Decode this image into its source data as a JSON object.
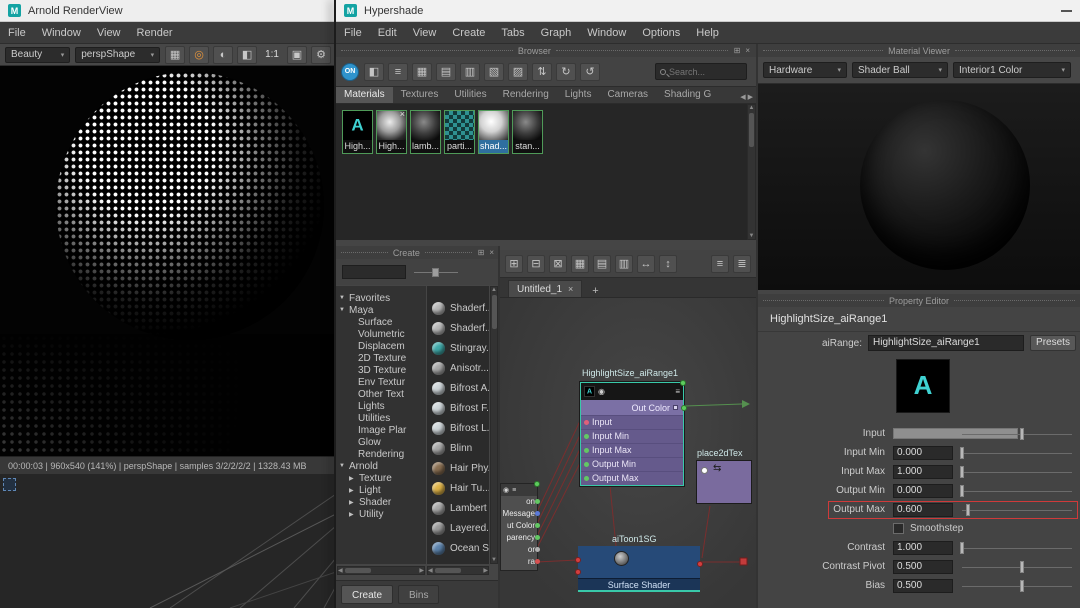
{
  "rv": {
    "title": "Arnold RenderView",
    "menu": [
      "File",
      "Window",
      "View",
      "Render"
    ],
    "aov": "Beauty",
    "camera": "perspShape",
    "zoom": "1:1",
    "icons_a": [
      {
        "name": "aov-grid-icon",
        "glyph": "▦",
        "color": "#c8c8c8"
      },
      {
        "name": "render-region-icon",
        "glyph": "◎",
        "color": "#e8953a"
      },
      {
        "name": "hdr-display-icon",
        "glyph": "◐",
        "color": "#c8c8c8"
      },
      {
        "name": "ab-compare-icon",
        "glyph": "◧",
        "color": "#c8c8c8"
      }
    ],
    "icons_b": [
      {
        "name": "snapshot-icon",
        "glyph": "▣",
        "color": "#c8c8c8"
      },
      {
        "name": "display-settings-gear-icon",
        "glyph": "⚙",
        "color": "#c8c8c8"
      }
    ],
    "status": "00:00:03 | 960x540 (141%) | perspShape | samples 3/2/2/2/2 | 1328.43 MB"
  },
  "hs": {
    "title": "Hypershade",
    "menu": [
      "File",
      "Edit",
      "View",
      "Create",
      "Tabs",
      "Graph",
      "Window",
      "Options",
      "Help"
    ],
    "panel_icons": [
      {
        "name": "float-panel-icon",
        "glyph": "⊞"
      },
      {
        "name": "close-panel-icon",
        "glyph": "×"
      }
    ],
    "browser": {
      "header": "Browser",
      "on_label": "ON",
      "toolbar_icons": [
        {
          "name": "palette-display-icon",
          "glyph": "◧"
        },
        {
          "name": "list-view-icon",
          "glyph": "≡"
        },
        {
          "name": "swatch-small-icon",
          "glyph": "▦"
        },
        {
          "name": "swatch-medium-icon",
          "glyph": "▤"
        },
        {
          "name": "swatch-large-icon",
          "glyph": "▥"
        },
        {
          "name": "swatch-xlarge-icon",
          "glyph": "▧"
        },
        {
          "name": "swatch-grid-icon",
          "glyph": "▨"
        },
        {
          "name": "sort-icon",
          "glyph": "⇅"
        },
        {
          "name": "refresh-swatch-icon",
          "glyph": "↻"
        },
        {
          "name": "refresh-all-icon",
          "glyph": "↺"
        }
      ],
      "search_placeholder": "Search...",
      "tabs": [
        {
          "label": "Materials",
          "cls": "active"
        },
        {
          "label": "Textures",
          "cls": ""
        },
        {
          "label": "Utilities",
          "cls": ""
        },
        {
          "label": "Rendering",
          "cls": ""
        },
        {
          "label": "Lights",
          "cls": ""
        },
        {
          "label": "Cameras",
          "cls": ""
        },
        {
          "label": "Shading G",
          "cls": ""
        }
      ],
      "swatches": [
        {
          "label": "High...",
          "cls": "sw-arnold",
          "lcls": ""
        },
        {
          "label": "High...",
          "cls": "sw-ball-gray badge-x",
          "lcls": ""
        },
        {
          "label": "lamb...",
          "cls": "sw-ball-dark",
          "lcls": ""
        },
        {
          "label": "parti...",
          "cls": "sw-checker",
          "lcls": ""
        },
        {
          "label": "shad...",
          "cls": "sw-ball-light",
          "lcls": "sel"
        },
        {
          "label": "stan...",
          "cls": "sw-ball-dark",
          "lcls": ""
        }
      ]
    },
    "create": {
      "header": "Create",
      "tree": [
        {
          "label": "Favorites",
          "arrow": "▼",
          "pad": "3px"
        },
        {
          "label": "Maya",
          "arrow": "▼",
          "pad": "3px"
        },
        {
          "label": "Surface",
          "arrow": "",
          "pad": "22px"
        },
        {
          "label": "Volumetric",
          "arrow": "",
          "pad": "22px"
        },
        {
          "label": "Displacem",
          "arrow": "",
          "pad": "22px"
        },
        {
          "label": "2D Texture",
          "arrow": "",
          "pad": "22px"
        },
        {
          "label": "3D Texture",
          "arrow": "",
          "pad": "22px"
        },
        {
          "label": "Env Textur",
          "arrow": "",
          "pad": "22px"
        },
        {
          "label": "Other Text",
          "arrow": "",
          "pad": "22px"
        },
        {
          "label": "Lights",
          "arrow": "",
          "pad": "22px"
        },
        {
          "label": "Utilities",
          "arrow": "",
          "pad": "22px"
        },
        {
          "label": "Image Plar",
          "arrow": "",
          "pad": "22px"
        },
        {
          "label": "Glow",
          "arrow": "",
          "pad": "22px"
        },
        {
          "label": "Rendering",
          "arrow": "",
          "pad": "22px"
        },
        {
          "label": "Arnold",
          "arrow": "▼",
          "pad": "3px"
        },
        {
          "label": "Texture",
          "arrow": "▶",
          "pad": "13px"
        },
        {
          "label": "Light",
          "arrow": "▶",
          "pad": "13px"
        },
        {
          "label": "Shader",
          "arrow": "▶",
          "pad": "13px"
        },
        {
          "label": "Utility",
          "arrow": "▶",
          "pad": "13px"
        }
      ],
      "nodes": [
        {
          "label": "Shaderf...",
          "color": "#b8b8b8"
        },
        {
          "label": "Shaderf...",
          "color": "#b8b8b8"
        },
        {
          "label": "Stingray...",
          "color": "#3fa9a9"
        },
        {
          "label": "Anisotr...",
          "color": "#a8a8a8"
        },
        {
          "label": "Bifrost A...",
          "color": "#cfd6da"
        },
        {
          "label": "Bifrost F...",
          "color": "#cfd6da"
        },
        {
          "label": "Bifrost L...",
          "color": "#cfd6da"
        },
        {
          "label": "Blinn",
          "color": "#a8a8a8"
        },
        {
          "label": "Hair Phy...",
          "color": "#8a6f52"
        },
        {
          "label": "Hair Tu...",
          "color": "#dfb347"
        },
        {
          "label": "Lambert",
          "color": "#a8a8a8"
        },
        {
          "label": "Layered...",
          "color": "#9a9a9a"
        },
        {
          "label": "Ocean S...",
          "color": "#5d84ad"
        }
      ],
      "tabs": [
        {
          "label": "Create",
          "cls": "active"
        },
        {
          "label": "Bins",
          "cls": ""
        }
      ]
    },
    "editor": {
      "toolbar_icons": [
        {
          "name": "input-connections-icon",
          "glyph": "⊞"
        },
        {
          "name": "io-connections-icon",
          "glyph": "⊟"
        },
        {
          "name": "output-connections-icon",
          "glyph": "⊠"
        },
        {
          "name": "layout-grid-icon",
          "glyph": "▦"
        },
        {
          "name": "align-horizontal-icon",
          "glyph": "▤"
        },
        {
          "name": "align-vertical-icon",
          "glyph": "▥"
        },
        {
          "name": "distribute-icon",
          "glyph": "↔"
        },
        {
          "name": "frame-all-icon",
          "glyph": "↕"
        }
      ],
      "view_icons": [
        {
          "name": "simple-view-icon",
          "glyph": "≡"
        },
        {
          "name": "detailed-view-icon",
          "glyph": "≣"
        }
      ],
      "tab": "Untitled_1",
      "tab_close": "×",
      "tab_add": "+",
      "range": {
        "title": "HighlightSize_aiRange1",
        "out": "Out Color",
        "rows": [
          {
            "label": "Input",
            "dot": "#e0607a"
          },
          {
            "label": "Input Min",
            "dot": "#63c763"
          },
          {
            "label": "Input Max",
            "dot": "#63c763"
          },
          {
            "label": "Output Min",
            "dot": "#63c763"
          },
          {
            "label": "Output Max",
            "dot": "#63c763"
          }
        ]
      },
      "place2d": {
        "title": "place2dTex"
      },
      "sg": {
        "title": "aiToon1SG",
        "footer": "Surface Shader"
      },
      "partial_rows": [
        {
          "label": "on",
          "dot": "#63c763"
        },
        {
          "label": "Message",
          "dot": "#5b79d8"
        },
        {
          "label": "ut Color",
          "dot": "#63c763"
        },
        {
          "label": "parency",
          "dot": "#63c763"
        },
        {
          "label": "or",
          "dot": "#b0b0b0"
        },
        {
          "label": "ra",
          "dot": "#d85050"
        }
      ]
    }
  },
  "mv": {
    "header": "Material Viewer",
    "renderer": "Hardware",
    "geometry": "Shader Ball",
    "environment": "Interior1 Color"
  },
  "pe": {
    "header": "Property Editor",
    "node_name": "HighlightSize_aiRange1",
    "type_label": "aiRange:",
    "type_value": "HighlightSize_aiRange1",
    "presets": "Presets",
    "attributes": [
      {
        "label": "Input",
        "is_bar": true,
        "has_slider": true,
        "handle": "53%"
      },
      {
        "label": "Input Min",
        "value": "0.000",
        "has_value": true,
        "has_slider": true,
        "handle": "0%"
      },
      {
        "label": "Input Max",
        "value": "1.000",
        "has_value": true,
        "has_slider": true,
        "handle": "0%"
      },
      {
        "label": "Output Min",
        "value": "0.000",
        "has_value": true,
        "has_slider": true,
        "handle": "0%"
      },
      {
        "label": "Output Max",
        "value": "0.600",
        "has_value": true,
        "has_slider": true,
        "handle": "5%",
        "highlight": true
      },
      {
        "label_after": "Smoothstep",
        "is_check": true
      },
      {
        "label": "Contrast",
        "value": "1.000",
        "has_value": true,
        "has_slider": true,
        "handle": "0%"
      },
      {
        "label": "Contrast Pivot",
        "value": "0.500",
        "has_value": true,
        "has_slider": true,
        "handle": "53%"
      },
      {
        "label": "Bias",
        "value": "0.500",
        "has_value": true,
        "has_slider": true,
        "handle": "53%"
      }
    ]
  }
}
